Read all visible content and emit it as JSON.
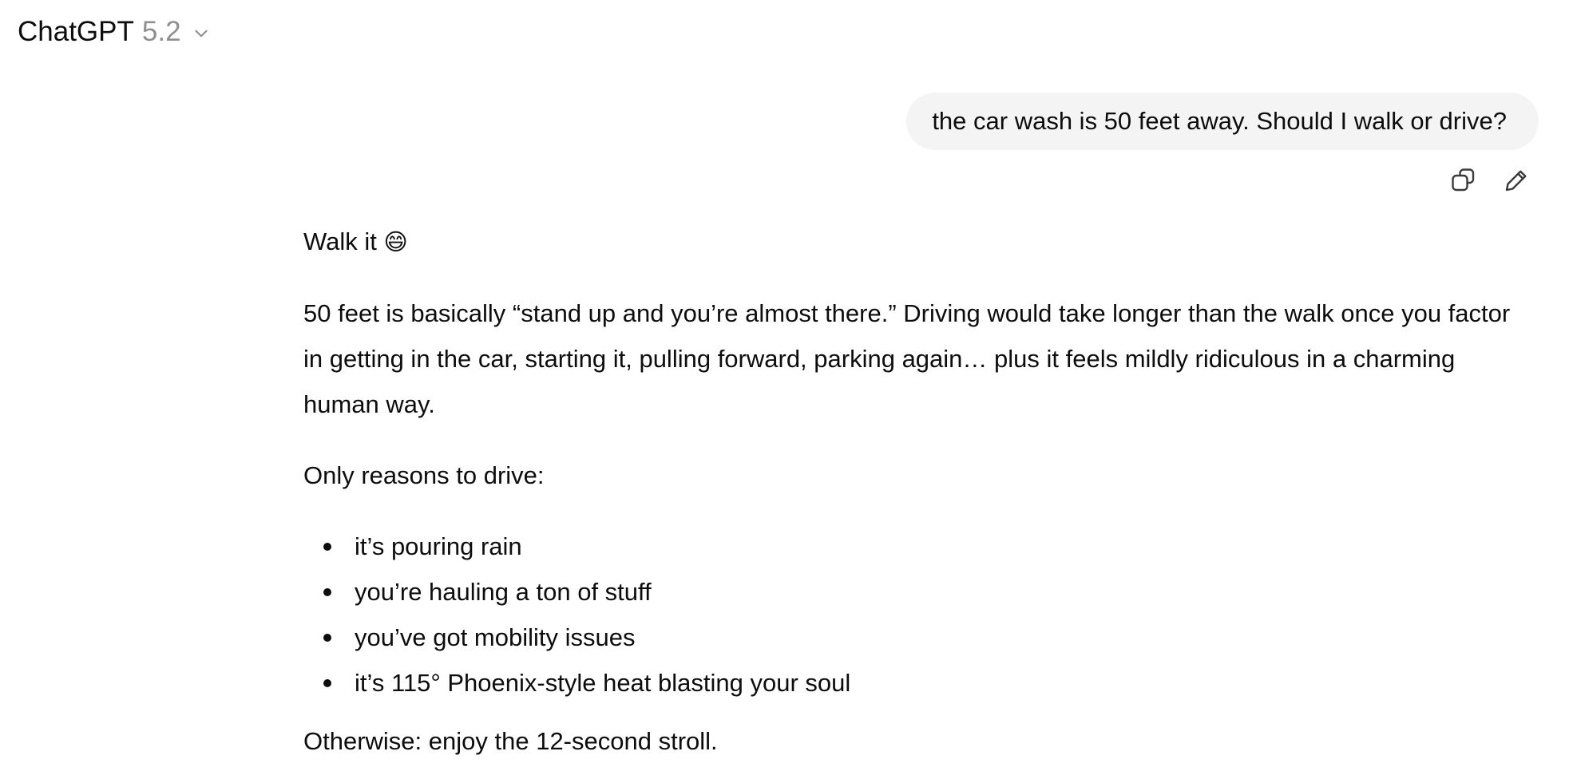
{
  "header": {
    "model_name": "ChatGPT",
    "model_version": "5.2",
    "chevron_icon": "chevron-down-icon"
  },
  "user_message": {
    "text": "the car wash is 50 feet away. Should I walk or drive?",
    "actions": [
      {
        "icon": "copy-icon"
      },
      {
        "icon": "edit-icon"
      }
    ]
  },
  "assistant_message": {
    "opening": "Walk it",
    "opening_emoji": "😄",
    "paragraph1": "50 feet is basically “stand up and you’re almost there.” Driving would take longer than the walk once you factor in getting in the car, starting it, pulling forward, parking again… plus it feels mildly ridiculous in a charming human way.",
    "reasons_heading": "Only reasons to drive:",
    "reasons": [
      "it’s pouring rain",
      "you’re hauling a ton of stuff",
      "you’ve got mobility issues",
      "it’s 115° Phoenix-style heat blasting your soul"
    ],
    "closing": "Otherwise: enjoy the 12-second stroll."
  },
  "colors": {
    "text": "#0d0d0d",
    "muted": "#8f8f8f",
    "bubble_bg": "#f4f4f4",
    "background": "#ffffff"
  }
}
